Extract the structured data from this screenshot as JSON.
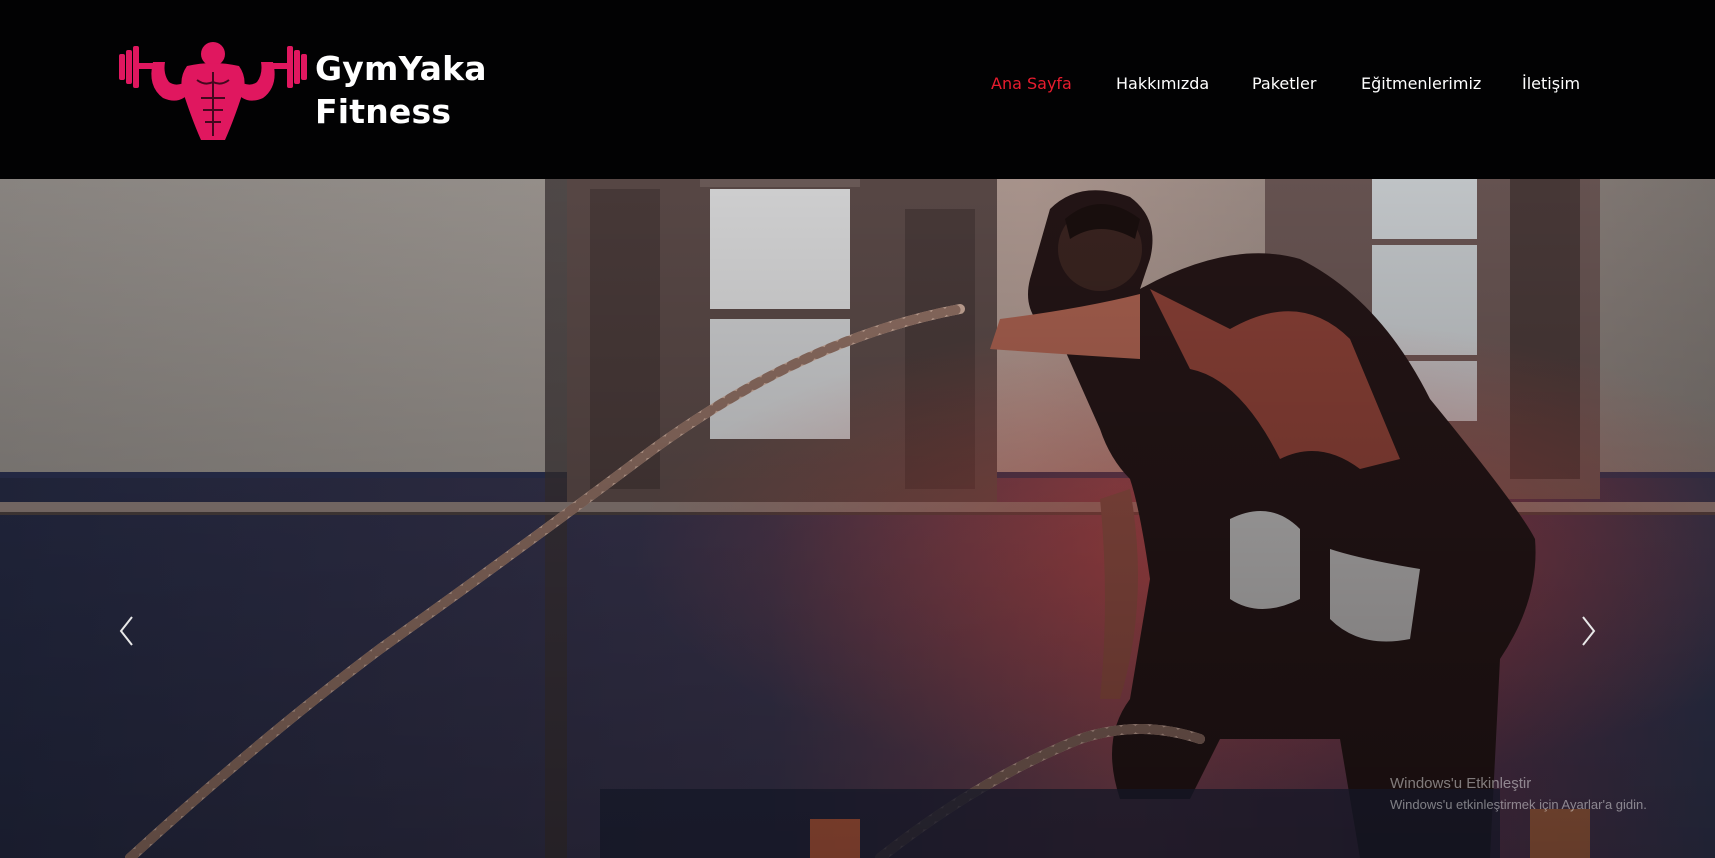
{
  "brand": {
    "name_line1": "GymYaka",
    "name_line2": "Fitness",
    "logo_icon": "muscleman-dumbbells-logo",
    "logo_color": "#e0175f"
  },
  "nav": {
    "items": [
      {
        "label": "Ana Sayfa",
        "active": true
      },
      {
        "label": "Hakkımızda",
        "active": false
      },
      {
        "label": "Paketler",
        "active": false
      },
      {
        "label": "Eğitmenlerimiz",
        "active": false
      },
      {
        "label": "İletişim",
        "active": false
      }
    ],
    "active_color": "#e81c2e"
  },
  "carousel": {
    "prev_icon": "chevron-left-icon",
    "next_icon": "chevron-right-icon",
    "slide_subject": "man training with battle ropes in gym"
  },
  "os_watermark": {
    "title": "Windows'u Etkinleştir",
    "subtitle": "Windows'u etkinleştirmek için Ayarlar'a gidin."
  }
}
